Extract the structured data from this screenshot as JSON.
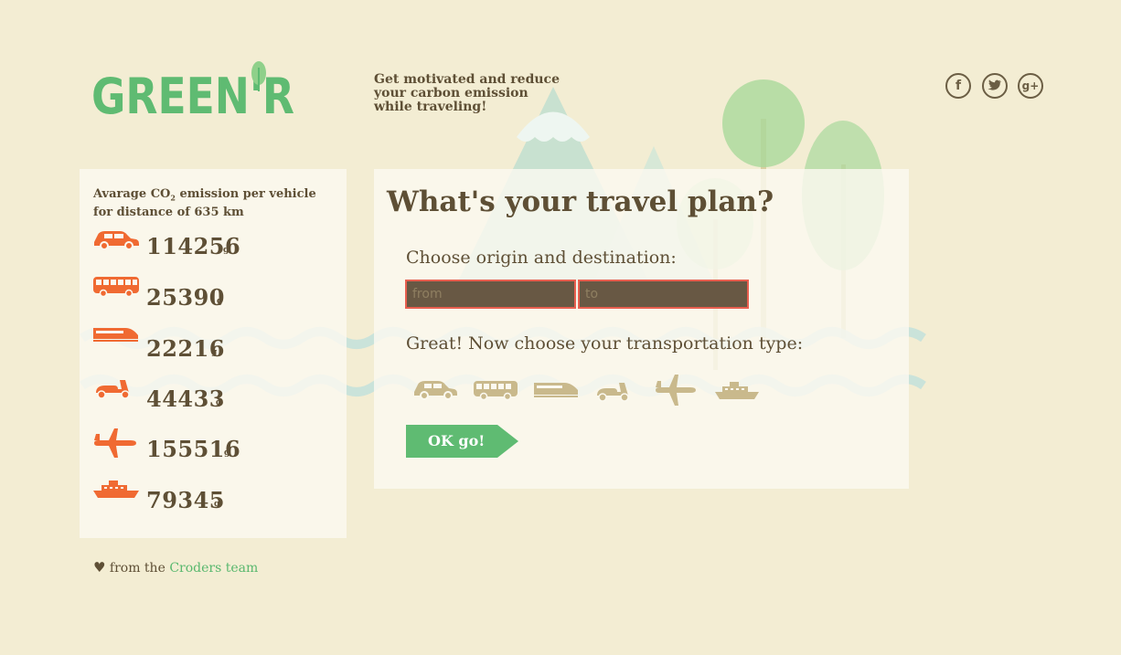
{
  "brand": {
    "logo_text": "GREEN'R",
    "tagline": [
      "Get motivated and reduce",
      "your carbon emission",
      "while traveling!"
    ]
  },
  "social": [
    {
      "icon": "facebook-icon",
      "glyph": "f"
    },
    {
      "icon": "twitter-icon",
      "glyph": "t"
    },
    {
      "icon": "google-plus-icon",
      "glyph": "g+"
    }
  ],
  "sidebar": {
    "title_pre": "Avarage CO",
    "title_sub": "2",
    "title_post": " emission per vehicle",
    "title_line2": "for distance of 635 km",
    "vehicles": [
      {
        "icon": "car-icon",
        "value": "114256",
        "unit": "g"
      },
      {
        "icon": "bus-icon",
        "value": "25390",
        "unit": "g"
      },
      {
        "icon": "train-icon",
        "value": "22216",
        "unit": "g"
      },
      {
        "icon": "scooter-icon",
        "value": "44433",
        "unit": "g"
      },
      {
        "icon": "airplane-icon",
        "value": "155516",
        "unit": "g"
      },
      {
        "icon": "ship-icon",
        "value": "79345",
        "unit": "g"
      }
    ]
  },
  "panel": {
    "title": "What's your travel plan?",
    "origin_label": "Choose origin and destination:",
    "from_placeholder": "from",
    "to_placeholder": "to",
    "transport_label": "Great! Now choose your transportation type:",
    "transport_types": [
      "car-icon",
      "bus-icon",
      "train-icon",
      "scooter-icon",
      "airplane-icon",
      "ship-icon"
    ],
    "ok_label": "OK go!"
  },
  "footer": {
    "heart": "♥",
    "from_text": " from the ",
    "team_link": "Croders team"
  },
  "colors": {
    "background": "#f3edd3",
    "accent_green": "#5fbb72",
    "icon_orange": "#f06a32",
    "icon_tan": "#c9b98c",
    "text_brown": "#5e4f35",
    "input_bg": "#685844",
    "input_border": "#e85f50"
  }
}
